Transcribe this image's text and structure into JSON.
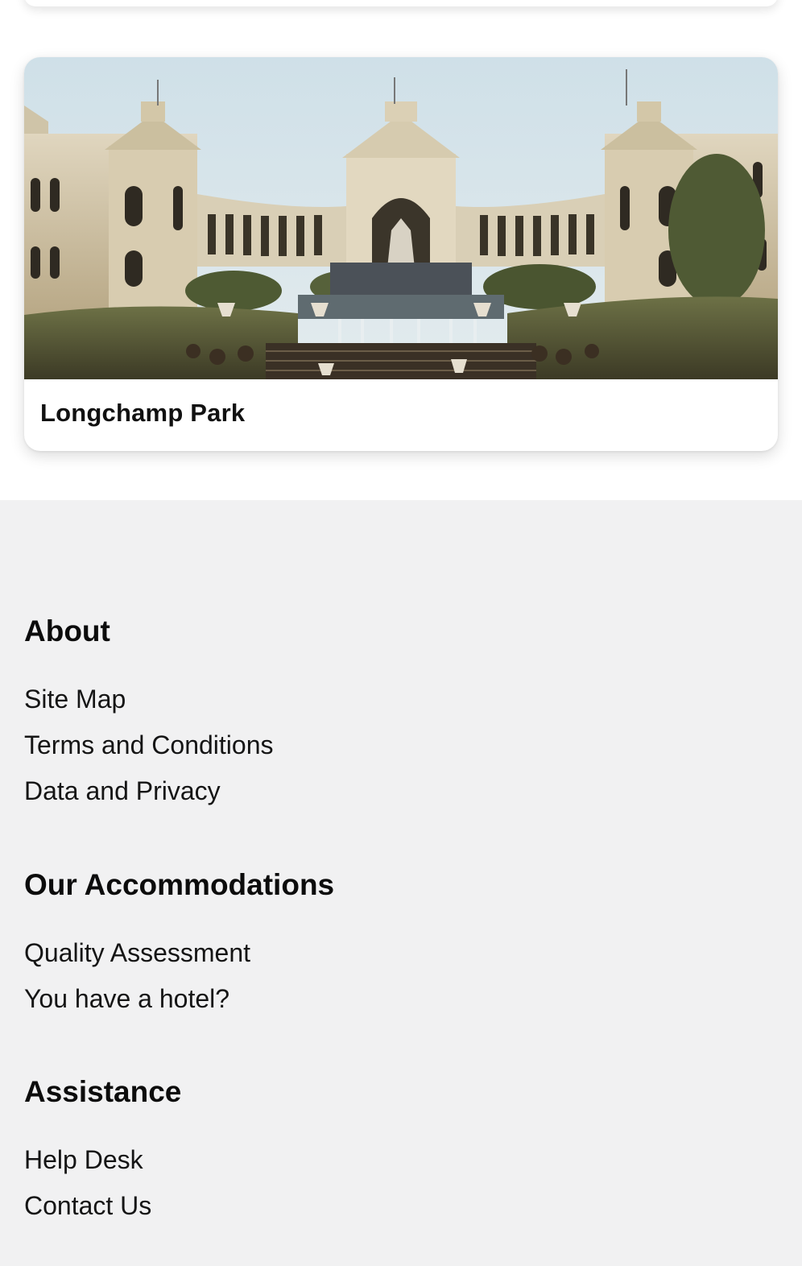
{
  "card": {
    "title": "Longchamp Park",
    "image_subject": "palace-colonnade-fountain-photo"
  },
  "footer": {
    "sections": [
      {
        "heading": "About",
        "links": [
          "Site Map",
          "Terms and Conditions",
          "Data and Privacy"
        ]
      },
      {
        "heading": "Our Accommodations",
        "links": [
          "Quality Assessment",
          "You have a hotel?"
        ]
      },
      {
        "heading": "Assistance",
        "links": [
          "Help Desk",
          "Contact Us"
        ]
      }
    ]
  },
  "colors": {
    "footer_background": "#f1f1f2",
    "text": "#111111",
    "card_background": "#ffffff"
  }
}
